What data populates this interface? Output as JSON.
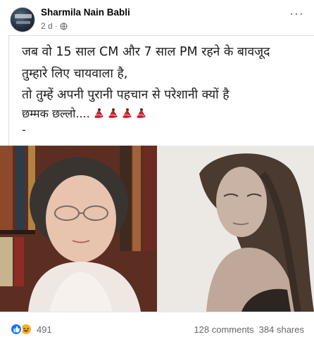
{
  "post": {
    "author": "Sharmila Nain Babli",
    "time": "2 d",
    "separator": "·",
    "more_label": "···"
  },
  "content": {
    "lines": [
      "जब वो 15 साल CM और 7 साल PM रहने के बावजूद",
      "तुम्हारे लिए चायवाला है,",
      "तो तुम्हें अपनी पुरानी पहचान से परेशानी क्यों है",
      "छम्मक छल्लो....",
      "-"
    ],
    "dancer_emoji_count": 4,
    "dancer_icon": "dancer-emoji-icon"
  },
  "images": {
    "left_alt": "older-woman-portrait-photo",
    "right_alt": "young-woman-black-and-white-photo"
  },
  "footer": {
    "reaction_icons": [
      "like-icon",
      "haha-icon"
    ],
    "reactions_count": "491",
    "comments": "128 comments",
    "shares": "384 shares"
  },
  "colors": {
    "accent": "#1877f2",
    "haha": "#f7b125",
    "muted": "#65676b",
    "dancer": "#c8202f"
  }
}
